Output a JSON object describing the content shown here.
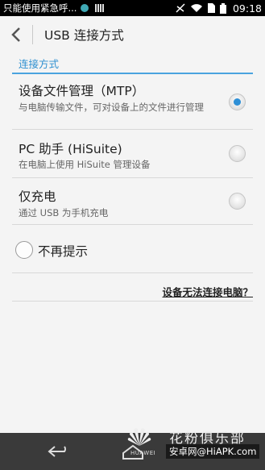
{
  "status_bar": {
    "notification_text": "只能使用紧急呼...",
    "time": "09:18"
  },
  "action_bar": {
    "title": "USB 连接方式",
    "back_icon": "chevron-left-icon"
  },
  "section": {
    "header": "连接方式"
  },
  "options": [
    {
      "title": "设备文件管理（MTP）",
      "subtitle": "与电脑传输文件，可对设备上的文件进行管理",
      "selected": true
    },
    {
      "title": "PC 助手 (HiSuite)",
      "subtitle": "在电脑上使用 HiSuite 管理设备",
      "selected": false
    },
    {
      "title": "仅充电",
      "subtitle": "通过 USB 为手机充电",
      "selected": false
    }
  ],
  "dont_remind": {
    "label": "不再提示",
    "checked": false
  },
  "help_link": "设备无法连接电脑？",
  "watermark": {
    "brand": "HUAWEI",
    "name": "花粉俱乐部",
    "url": "安卓网@HiAPK.com"
  },
  "colors": {
    "accent": "#2d8fd0",
    "background": "#f4f4f4",
    "nav_bar": "#3a3a3a"
  }
}
